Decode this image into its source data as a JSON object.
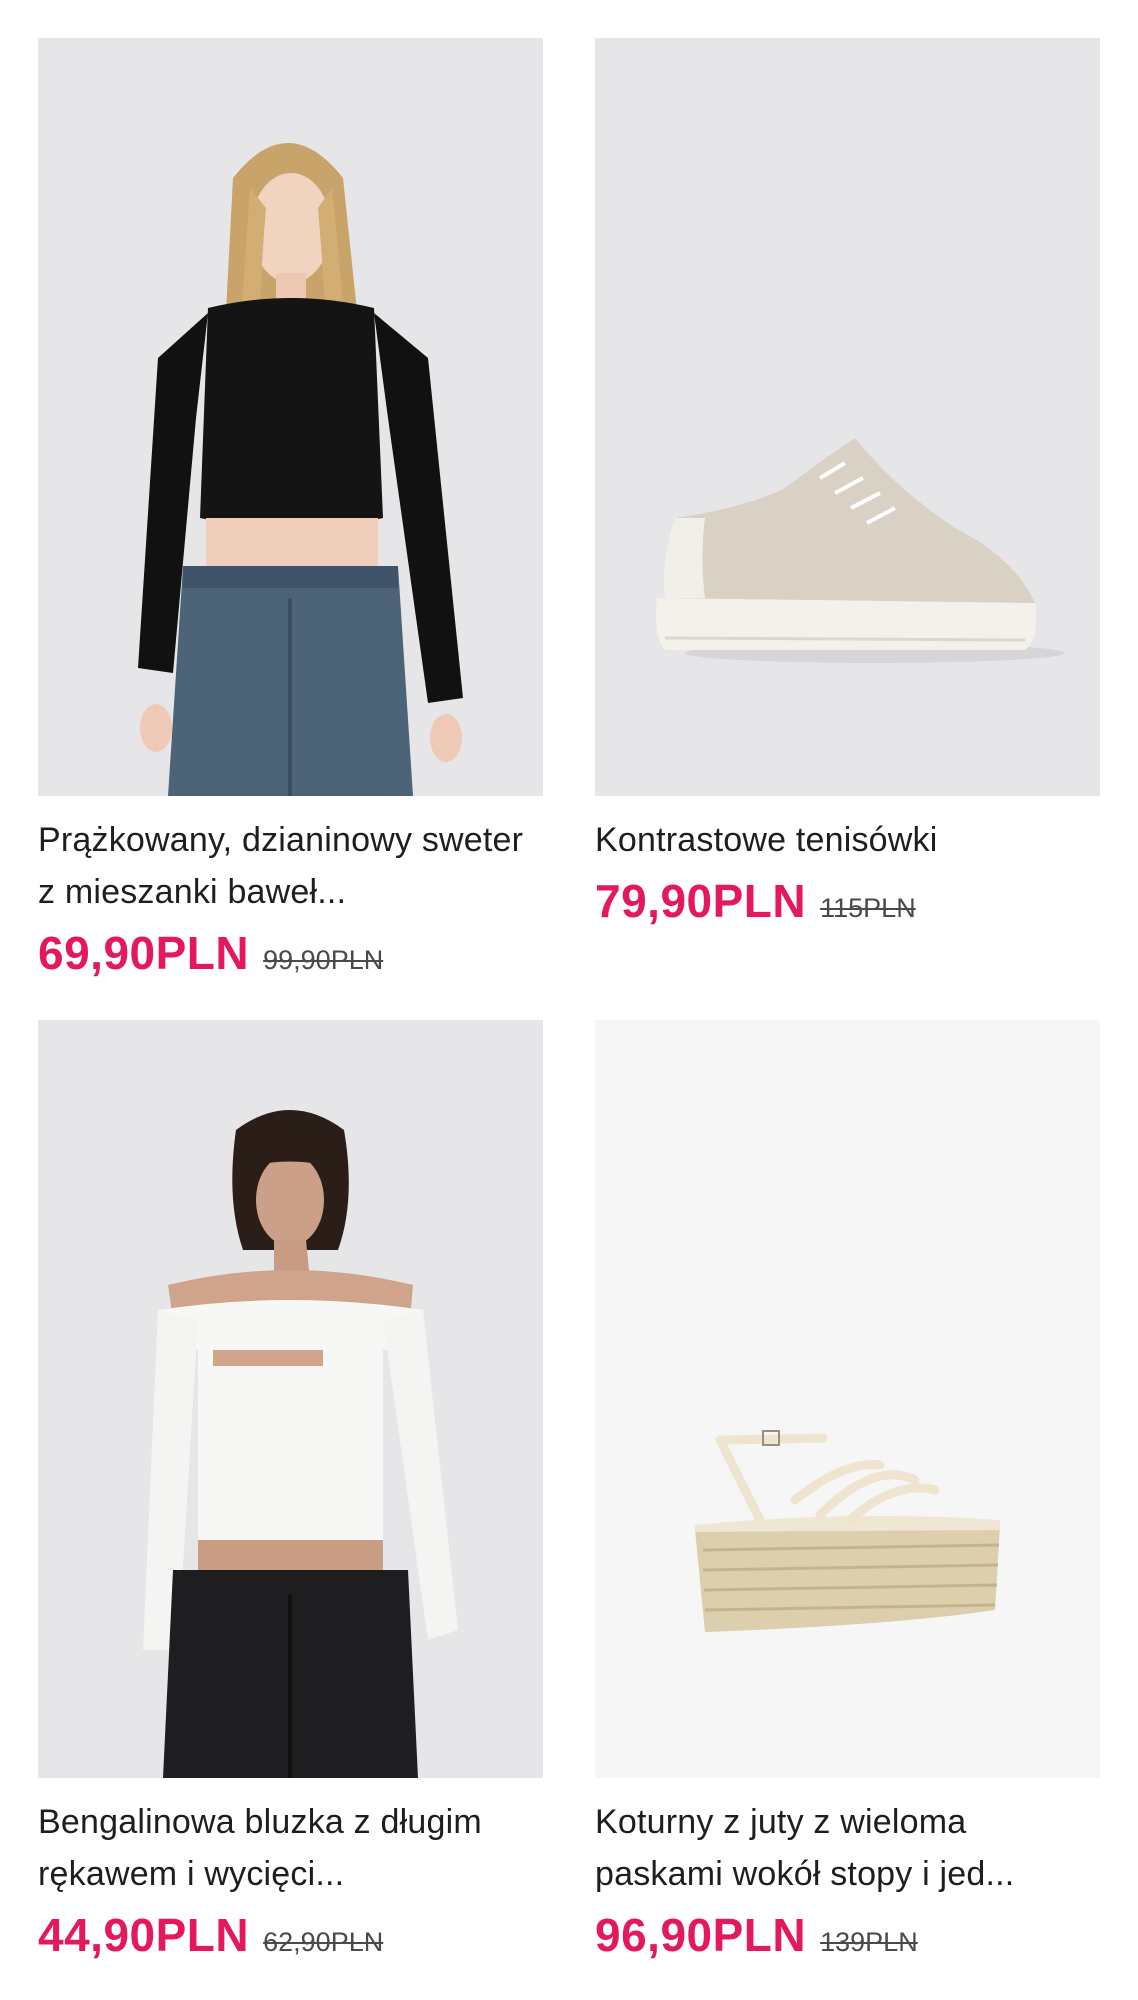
{
  "products": [
    {
      "title": "Prążkowany, dzianinowy sweter z mieszanki baweł...",
      "price": "69,90PLN",
      "old_price": "99,90PLN"
    },
    {
      "title": "Kontrastowe tenisówki",
      "price": "79,90PLN",
      "old_price": "115PLN"
    },
    {
      "title": "Bengalinowa bluzka z długim rękawem i wycięci...",
      "price": "44,90PLN",
      "old_price": "62,90PLN"
    },
    {
      "title": "Koturny z juty z wieloma paskami wokół stopy i jed...",
      "price": "96,90PLN",
      "old_price": "139PLN"
    }
  ],
  "colors": {
    "sale_price": "#e4185f",
    "photo_background": "#e6e6e8"
  }
}
